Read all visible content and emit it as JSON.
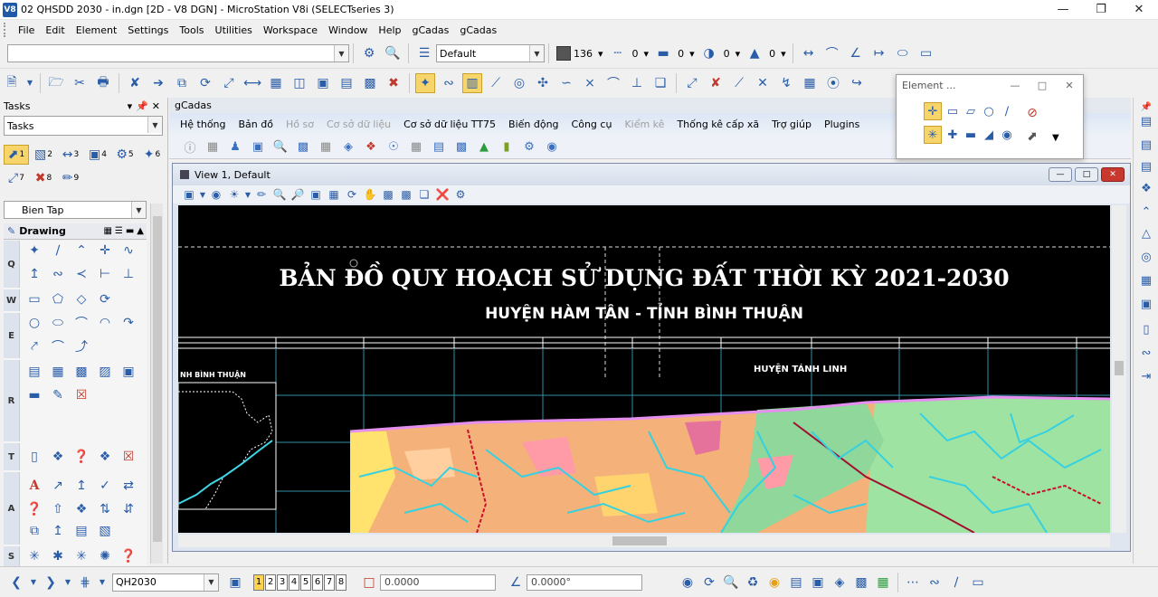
{
  "window": {
    "title": "02 QHSDD 2030 - in.dgn [2D - V8 DGN] - MicroStation V8i (SELECTseries 3)",
    "app_icon": "V8"
  },
  "menu": [
    "File",
    "Edit",
    "Element",
    "Settings",
    "Tools",
    "Utilities",
    "Workspace",
    "Window",
    "Help",
    "gCadas",
    "gCadas"
  ],
  "attributes": {
    "level": "Default",
    "color": "136",
    "style": "0",
    "weight": "0",
    "transparency": "0",
    "priority": "0",
    "swatch_color": "#555555"
  },
  "tasks_panel": {
    "header": "Tasks",
    "combo": "Tasks",
    "bien_tap": "Bien Tap",
    "drawing": "Drawing",
    "categories": [
      "Q",
      "W",
      "E",
      "R",
      "T",
      "A",
      "S"
    ],
    "tool_numbers": [
      "1",
      "2",
      "3",
      "4",
      "5",
      "6",
      "7",
      "8",
      "9"
    ]
  },
  "gcadas": {
    "title": "gCadas",
    "menu": [
      {
        "label": "Hệ thống",
        "enabled": true
      },
      {
        "label": "Bản đồ",
        "enabled": true
      },
      {
        "label": "Hồ sơ",
        "enabled": false
      },
      {
        "label": "Cơ sở dữ liệu",
        "enabled": false
      },
      {
        "label": "Cơ sở dữ liệu TT75",
        "enabled": true
      },
      {
        "label": "Biến động",
        "enabled": true
      },
      {
        "label": "Công cụ",
        "enabled": true
      },
      {
        "label": "Kiểm kê",
        "enabled": false
      },
      {
        "label": "Thống kê cấp xã",
        "enabled": true
      },
      {
        "label": "Trợ giúp",
        "enabled": true
      },
      {
        "label": "Plugins",
        "enabled": true
      }
    ]
  },
  "element_box": {
    "title": "Element ..."
  },
  "view": {
    "title": "View 1, Default",
    "map_title": "BẢN ĐỒ QUY HOẠCH SỬ DỤNG ĐẤT THỜI KỲ 2021-2030",
    "map_subtitle": "HUYỆN HÀM TÂN - TỈNH BÌNH THUẬN",
    "label_tanh_linh": "HUYỆN TÁNH LINH",
    "label_binh_thuan": "NH BÌNH THUẬN"
  },
  "status": {
    "level": "QH2030",
    "views": [
      "1",
      "2",
      "3",
      "4",
      "5",
      "6",
      "7",
      "8"
    ],
    "active_view": "1",
    "distance": "0.0000",
    "angle": "0.0000°"
  }
}
